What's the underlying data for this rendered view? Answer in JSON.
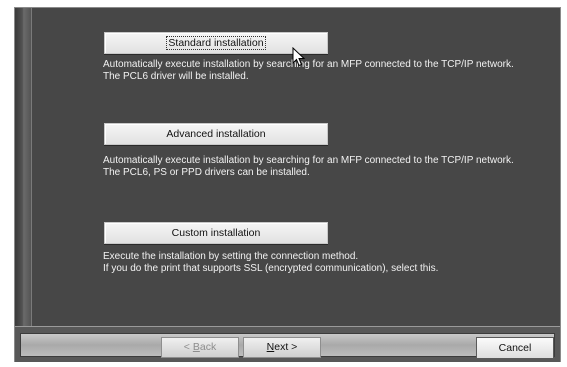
{
  "options": [
    {
      "label": "Standard installation",
      "desc_line1": "Automatically execute installation by searching for an MFP connected to the TCP/IP network.",
      "desc_line2": "The PCL6 driver will be installed."
    },
    {
      "label": "Advanced installation",
      "desc_line1": "Automatically execute installation by searching for an MFP connected to the TCP/IP network.",
      "desc_line2": "The PCL6, PS or PPD drivers can be installed."
    },
    {
      "label": "Custom installation",
      "desc_line1": "Execute the installation by setting the connection method.",
      "desc_line2": "If you do the print that supports SSL (encrypted communication), select this."
    }
  ],
  "footer": {
    "back": {
      "prefix": "< ",
      "accel": "B",
      "rest": "ack"
    },
    "next": {
      "accel": "N",
      "rest": "ext",
      "suffix": " >"
    },
    "cancel_label": "Cancel"
  }
}
